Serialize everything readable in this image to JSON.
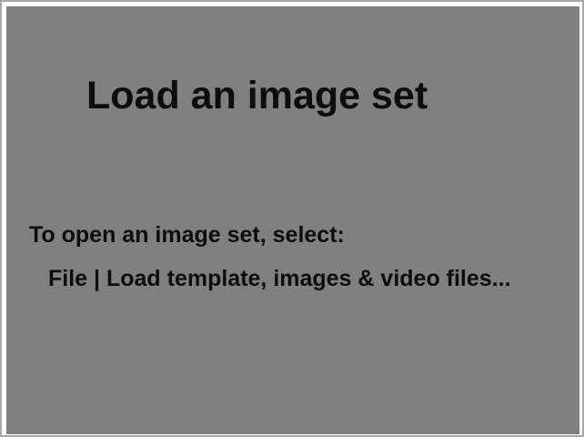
{
  "panel": {
    "title": "Load an image set",
    "instruction": "To open an image set, select:",
    "menu_path": "File | Load template, images & video files..."
  },
  "colors": {
    "panel_background": "#808080",
    "text": "#0d0d0d",
    "frame_border": "#a8a8a8"
  }
}
